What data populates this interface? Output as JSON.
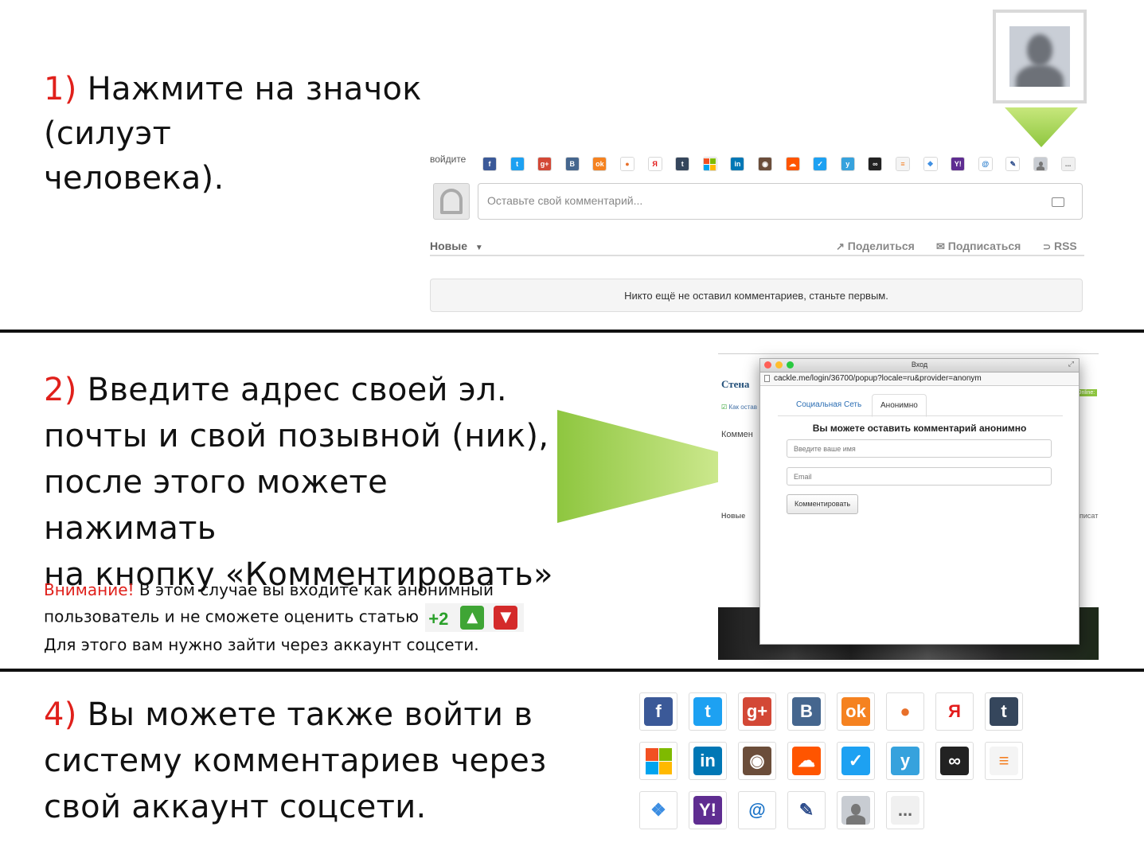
{
  "step1": {
    "number": "1)",
    "text_line1": "Нажмите на значок (силуэт",
    "text_line2": "человека)."
  },
  "widget": {
    "login_label": "войдите",
    "comment_placeholder": "Оставьте свой комментарий...",
    "sort_label": "Новые",
    "share_label": "Поделиться",
    "subscribe_label": "Подписаться",
    "rss_label": "RSS",
    "empty_message": "Никто ещё не оставил комментариев, станьте первым."
  },
  "step2": {
    "number": "2)",
    "line1": "Введите адрес своей эл.",
    "line2": "почты и свой позывной (ник),",
    "line3": "после этого можете нажимать",
    "line4": "на кнопку «Комментировать»",
    "warning_word": "Внимание!",
    "warning_line1": " В этом случае вы входите как анонимный",
    "warning_line2": "пользователь и не сможете оценить статью",
    "rating_value": "+2",
    "warning_line3": "Для этого вам нужно зайти через аккаунт соцсети."
  },
  "popup": {
    "window_title": "Вход",
    "url": "cackle.me/login/36700/popup?locale=ru&provider=anonym",
    "tab_social": "Социальная Сеть",
    "tab_anon": "Анонимно",
    "heading": "Вы можете оставить комментарий анонимно",
    "name_placeholder": "Введите ваше имя",
    "email_placeholder": "Email",
    "submit_label": "Комментировать",
    "bg_title": "Стена",
    "bg_check": "Как остав",
    "bg_comments": "Коммен",
    "bg_new": "Новые",
    "bg_online": "Online:",
    "bg_subscribe": "писат"
  },
  "step4": {
    "number": "4)",
    "line1": "Вы можете также войти в",
    "line2": "систему комментариев через",
    "line3": "свой аккаунт соцсети."
  },
  "colors": {
    "accent_red": "#e0201b",
    "arrow_green": "#b5de6a"
  },
  "icons": [
    {
      "name": "facebook-icon",
      "glyph": "f",
      "bg": "#3b5998"
    },
    {
      "name": "twitter-icon",
      "glyph": "t",
      "bg": "#1da1f2"
    },
    {
      "name": "google-plus-icon",
      "glyph": "g+",
      "bg": "#d34836"
    },
    {
      "name": "vkontakte-icon",
      "glyph": "B",
      "bg": "#45668e"
    },
    {
      "name": "odnoklassniki-icon",
      "glyph": "ok",
      "bg": "#f58220"
    },
    {
      "name": "mailru-agent-icon",
      "glyph": "●",
      "bg": "#ffffff"
    },
    {
      "name": "yandex-icon",
      "glyph": "Я",
      "bg": "#ffffff"
    },
    {
      "name": "tumblr-icon",
      "glyph": "t",
      "bg": "#35465c"
    },
    {
      "name": "microsoft-icon",
      "glyph": "",
      "bg": "#ffffff"
    },
    {
      "name": "linkedin-icon",
      "glyph": "in",
      "bg": "#0077b5"
    },
    {
      "name": "instagram-icon",
      "glyph": "◉",
      "bg": "#6b4d3a"
    },
    {
      "name": "soundcloud-icon",
      "glyph": "☁",
      "bg": "#ff5500"
    },
    {
      "name": "foursquare-icon",
      "glyph": "✓",
      "bg": "#1da1f2"
    },
    {
      "name": "yammer-icon",
      "glyph": "y",
      "bg": "#36a2dd"
    },
    {
      "name": "livejournal-icon",
      "glyph": "∞",
      "bg": "#222222"
    },
    {
      "name": "stackoverflow-icon",
      "glyph": "≡",
      "bg": "#f4f4f4"
    },
    {
      "name": "dropbox-icon",
      "glyph": "❖",
      "bg": "#ffffff"
    },
    {
      "name": "yahoo-icon",
      "glyph": "Y!",
      "bg": "#5f2d91"
    },
    {
      "name": "mail-at-icon",
      "glyph": "@",
      "bg": "#ffffff"
    },
    {
      "name": "pencil-icon",
      "glyph": "✎",
      "bg": "#ffffff"
    },
    {
      "name": "anonymous-user-icon",
      "glyph": "",
      "bg": "#c8ccd2"
    },
    {
      "name": "more-icon",
      "glyph": "...",
      "bg": "#f0f0f0"
    }
  ]
}
